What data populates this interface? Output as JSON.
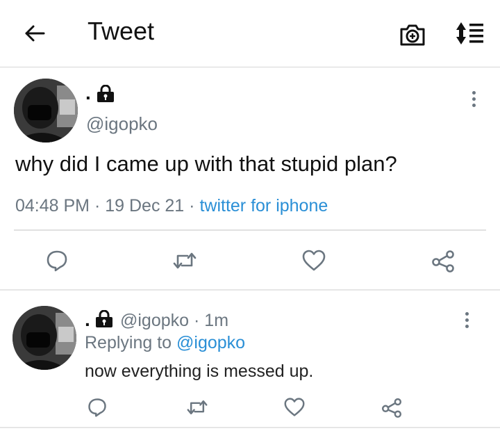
{
  "header": {
    "title": "Tweet",
    "back_icon": "arrow-left-icon",
    "camera_icon": "camera-plus-icon",
    "sort_icon": "sort-lines-icon"
  },
  "tweet": {
    "display_name": ".",
    "handle": "@igopko",
    "text": "why did I came up with that stupid plan?",
    "time": "04:48 PM",
    "separator": "·",
    "date": "19 Dec 21",
    "source": "twitter for iphone"
  },
  "reply": {
    "display_name": ".",
    "handle": "@igopko",
    "separator": "·",
    "age": "1m",
    "replying_prefix": "Replying to",
    "replying_to": "@igopko",
    "text": "now everything is messed up."
  },
  "colors": {
    "link": "#2a8fd6",
    "muted": "#6b7680",
    "icon": "#6b7680"
  }
}
